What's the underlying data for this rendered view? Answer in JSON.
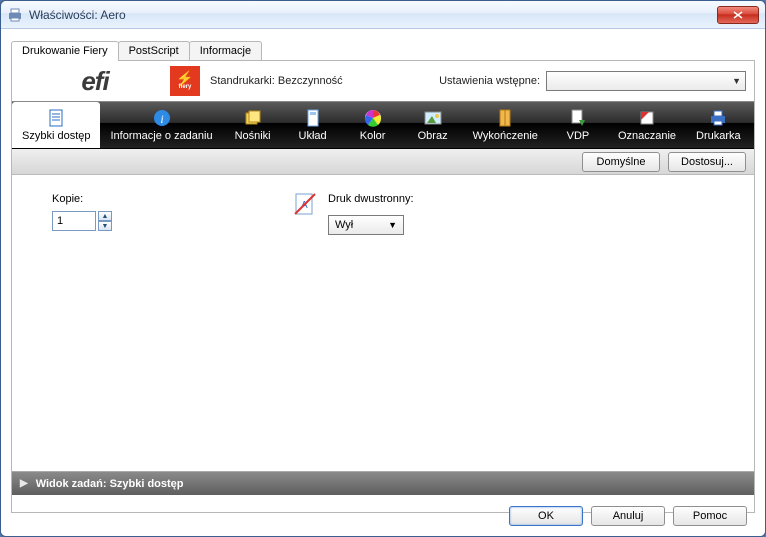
{
  "window": {
    "title": "Właściwości: Aero"
  },
  "tabs": [
    {
      "label": "Drukowanie Fiery",
      "active": true
    },
    {
      "label": "PostScript",
      "active": false
    },
    {
      "label": "Informacje",
      "active": false
    }
  ],
  "header": {
    "efi_text": "efi",
    "status_label": "Standrukarki:",
    "status_value": "Bezczynność",
    "presets_label": "Ustawienia wstępne:",
    "presets_value": ""
  },
  "toolbar": [
    {
      "key": "quick",
      "label": "Szybki dostęp",
      "active": true
    },
    {
      "key": "jobinfo",
      "label": "Informacje o zadaniu",
      "active": false
    },
    {
      "key": "media",
      "label": "Nośniki",
      "active": false
    },
    {
      "key": "layout",
      "label": "Układ",
      "active": false
    },
    {
      "key": "color",
      "label": "Kolor",
      "active": false
    },
    {
      "key": "image",
      "label": "Obraz",
      "active": false
    },
    {
      "key": "finish",
      "label": "Wykończenie",
      "active": false
    },
    {
      "key": "vdp",
      "label": "VDP",
      "active": false
    },
    {
      "key": "stamp",
      "label": "Oznaczanie",
      "active": false
    },
    {
      "key": "printer",
      "label": "Drukarka",
      "active": false
    }
  ],
  "subbar": {
    "defaults": "Domyślne",
    "customize": "Dostosuj..."
  },
  "quick": {
    "copies_label": "Kopie:",
    "copies_value": "1",
    "duplex_label": "Druk dwustronny:",
    "duplex_value": "Wył"
  },
  "taskview": {
    "prefix": "Widok zadań:",
    "value": "Szybki dostęp"
  },
  "footer": {
    "ok": "OK",
    "cancel": "Anuluj",
    "help": "Pomoc"
  }
}
